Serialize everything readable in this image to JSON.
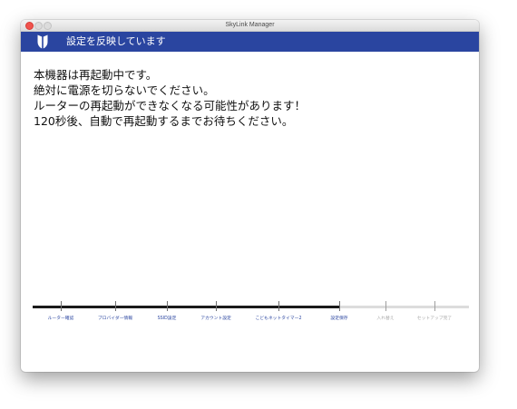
{
  "window": {
    "title": "SkyLink Manager"
  },
  "header": {
    "title": "設定を反映しています",
    "logo_icon": "shield-logo-icon",
    "color": "#2a45a0"
  },
  "message": {
    "lines": [
      "本機器は再起動中です。",
      "絶対に電源を切らないでください。",
      "ルーターの再起動ができなくなる可能性があります！",
      "120秒後、自動で再起動するまでお待ちください。"
    ]
  },
  "progress": {
    "steps": [
      {
        "label": "ルーター確認",
        "active": true
      },
      {
        "label": "プロバイダー情報",
        "active": true
      },
      {
        "label": "SSID設定",
        "active": true
      },
      {
        "label": "アカウント設定",
        "active": true
      },
      {
        "label": "こどもネットタイマー2",
        "active": true
      },
      {
        "label": "設定保存",
        "active": true
      },
      {
        "label": "入れ替え",
        "active": false
      },
      {
        "label": "セットアップ完了",
        "active": false
      }
    ],
    "current_step": 6,
    "total_steps": 8,
    "active_label_color": "#2a45a0",
    "inactive_label_color": "#a8a8a8"
  }
}
